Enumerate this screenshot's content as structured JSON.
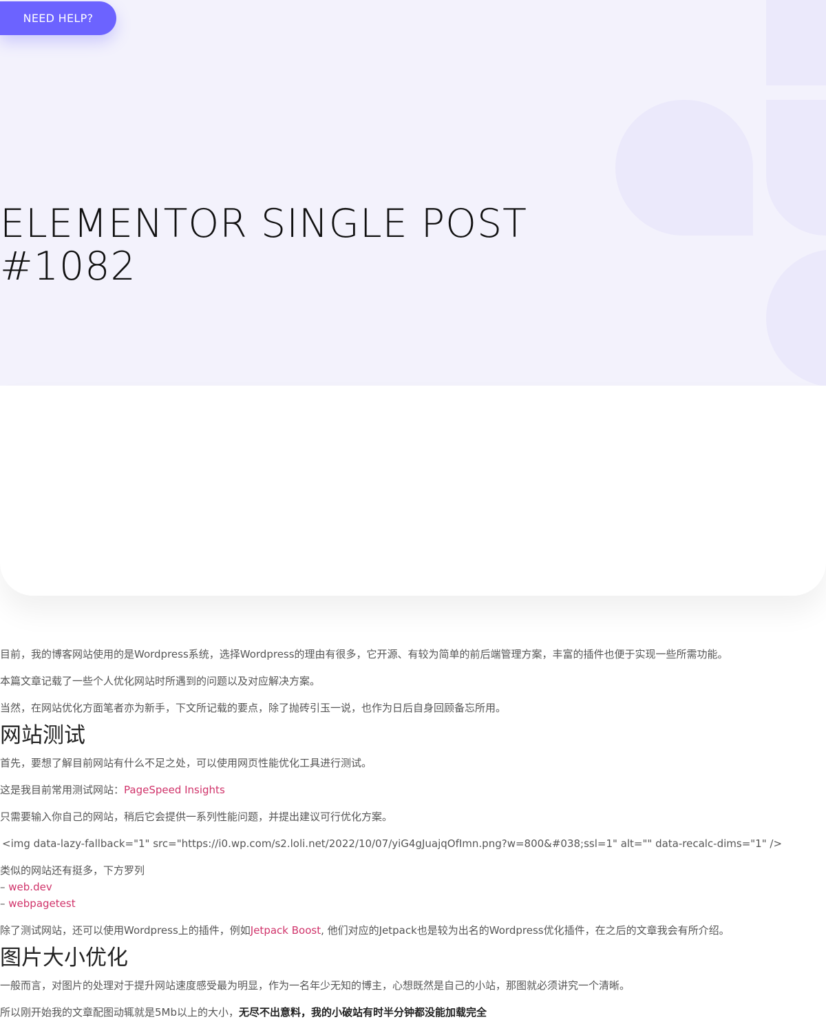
{
  "help_button": "NEED HELP?",
  "title_line1": "ELEMENTOR SINGLE POST",
  "title_line2": "#1082",
  "paragraphs": {
    "p1": "目前，我的博客网站使用的是Wordpress系统，选择Wordpress的理由有很多，它开源、有较为简单的前后端管理方案，丰富的插件也便于实现一些所需功能。",
    "p2": "本篇文章记载了一些个人优化网站时所遇到的问题以及对应解决方案。",
    "p3": "当然，在网站优化方面笔者亦为新手，下文所记载的要点，除了抛砖引玉一说，也作为日后自身回顾备忘所用。",
    "h_test": "网站测试",
    "p4": "首先，要想了解目前网站有什么不足之处，可以使用网页性能优化工具进行测试。",
    "p5_prefix": "这是我目前常用测试网站：",
    "p5_link": "PageSpeed Insights",
    "p6": "只需要输入你自己的网站，稍后它会提供一系列性能问题，并提出建议可行优化方案。",
    "img_code": "<img data-lazy-fallback=\"1\" src=\"https://i0.wp.com/s2.loli.net/2022/10/07/yiG4gJuajqOfImn.png?w=800&#038;ssl=1\" alt=\"\" data-recalc-dims=\"1\" />",
    "p7_line1": "类似的网站还有挺多，下方罗列",
    "p7_dash1": "– ",
    "p7_link1": "web.dev",
    "p7_dash2": "– ",
    "p7_link2": "webpagetest",
    "p8_prefix": "除了测试网站，还可以使用Wordpress上的插件，例如",
    "p8_link": "Jetpack Boost",
    "p8_suffix": ", 他们对应的Jetpack也是较为出名的Wordpress优化插件，在之后的文章我会有所介绍。",
    "h_img": "图片大小优化",
    "p9": "一般而言，对图片的处理对于提升网站速度感受最为明显，作为一名年少无知的博主，心想既然是自己的小站，那图就必须讲究一个清晰。",
    "p10_prefix": "所以刚开始我的文章配图动辄就是5Mb以上的大小，",
    "p10_bold": "无尽不出意料，我的小破站有时半分钟都没能加载完全"
  }
}
